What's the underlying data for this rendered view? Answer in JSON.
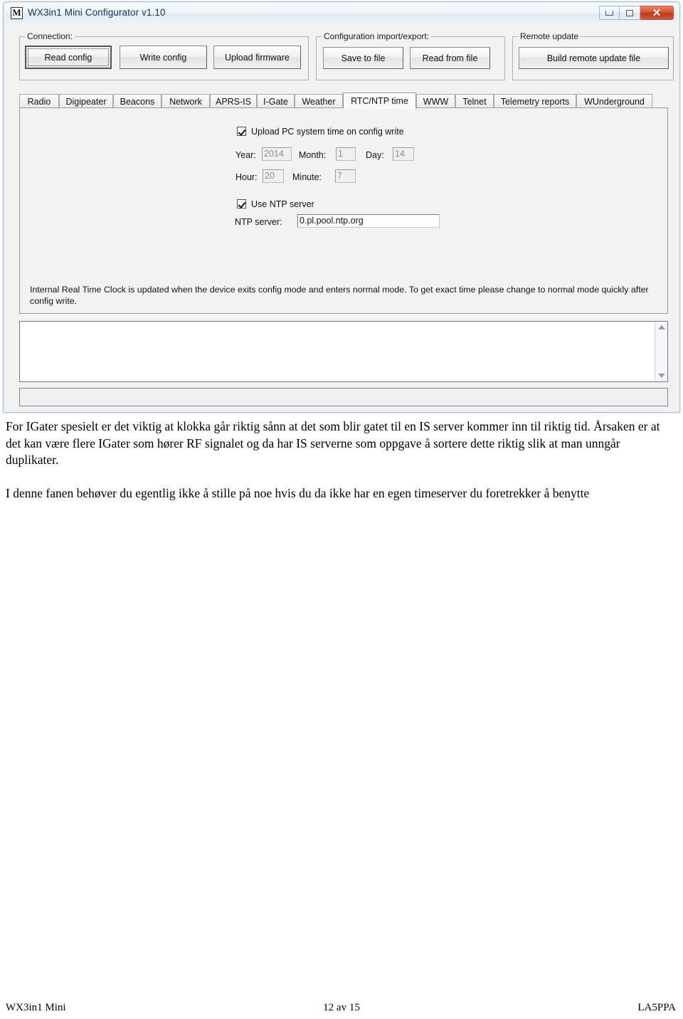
{
  "window": {
    "title": "WX3in1 Mini Configurator v1.10",
    "icon": "M",
    "controls": {
      "minimize": "minimize",
      "maximize": "maximize",
      "close": "✕"
    }
  },
  "toolbar": {
    "groups": [
      {
        "title": "Connection:",
        "buttons": [
          {
            "label": "Read config",
            "focused": true
          },
          {
            "label": "Write config",
            "focused": false
          },
          {
            "label": "Upload firmware",
            "focused": false
          }
        ]
      },
      {
        "title": "Configuration import/export:",
        "buttons": [
          {
            "label": "Save to file",
            "focused": false
          },
          {
            "label": "Read from file",
            "focused": false
          }
        ]
      },
      {
        "title": "Remote update",
        "buttons": [
          {
            "label": "Build remote update file",
            "focused": false
          }
        ]
      }
    ]
  },
  "tabs": {
    "selected": "RTC/NTP time",
    "items": [
      {
        "label": "Radio"
      },
      {
        "label": "Digipeater"
      },
      {
        "label": "Beacons"
      },
      {
        "label": "Network"
      },
      {
        "label": "APRS-IS"
      },
      {
        "label": "I-Gate"
      },
      {
        "label": "Weather"
      },
      {
        "label": "RTC/NTP time"
      },
      {
        "label": "WWW"
      },
      {
        "label": "Telnet"
      },
      {
        "label": "Telemetry reports"
      },
      {
        "label": "WUnderground"
      }
    ]
  },
  "rtc_tab": {
    "upload_time_checkbox": {
      "label": "Upload PC system time on config write",
      "checked": true
    },
    "fields": [
      {
        "label": "Year:",
        "value": "2014",
        "enabled": false
      },
      {
        "label": "Month:",
        "value": "1",
        "enabled": false
      },
      {
        "label": "Day:",
        "value": "14",
        "enabled": false
      },
      {
        "label": "Hour:",
        "value": "20",
        "enabled": false
      },
      {
        "label": "Minute:",
        "value": "7",
        "enabled": false
      }
    ],
    "use_ntp_checkbox": {
      "label": "Use NTP server",
      "checked": true
    },
    "ntp_server": {
      "label": "NTP server:",
      "value": "0.pl.pool.ntp.org",
      "enabled": true
    },
    "info_text": "Internal Real Time Clock is updated when the device exits config mode and enters normal mode. To get exact time please change to normal mode quickly after config write."
  },
  "log": {
    "value": ""
  },
  "statusbar": {
    "text": ""
  },
  "document": {
    "paragraph1": "For IGater spesielt er det viktig at klokka går riktig sånn at det som blir gatet til en IS server kommer inn til riktig tid. Årsaken er at det kan være flere IGater som hører RF signalet og da har IS serverne som oppgave å sortere dette riktig slik at man unngår duplikater.",
    "paragraph2": "I denne fanen behøver du egentlig ikke å stille på noe hvis du da ikke har en egen timeserver du foretrekker å benytte"
  },
  "footer": {
    "left": "WX3in1 Mini",
    "center": "12 av 15",
    "right": "LA5PPA"
  },
  "colors": {
    "close_button": "#c4411f",
    "title_text": "#14314f",
    "window_border": "#a9c0d8"
  }
}
